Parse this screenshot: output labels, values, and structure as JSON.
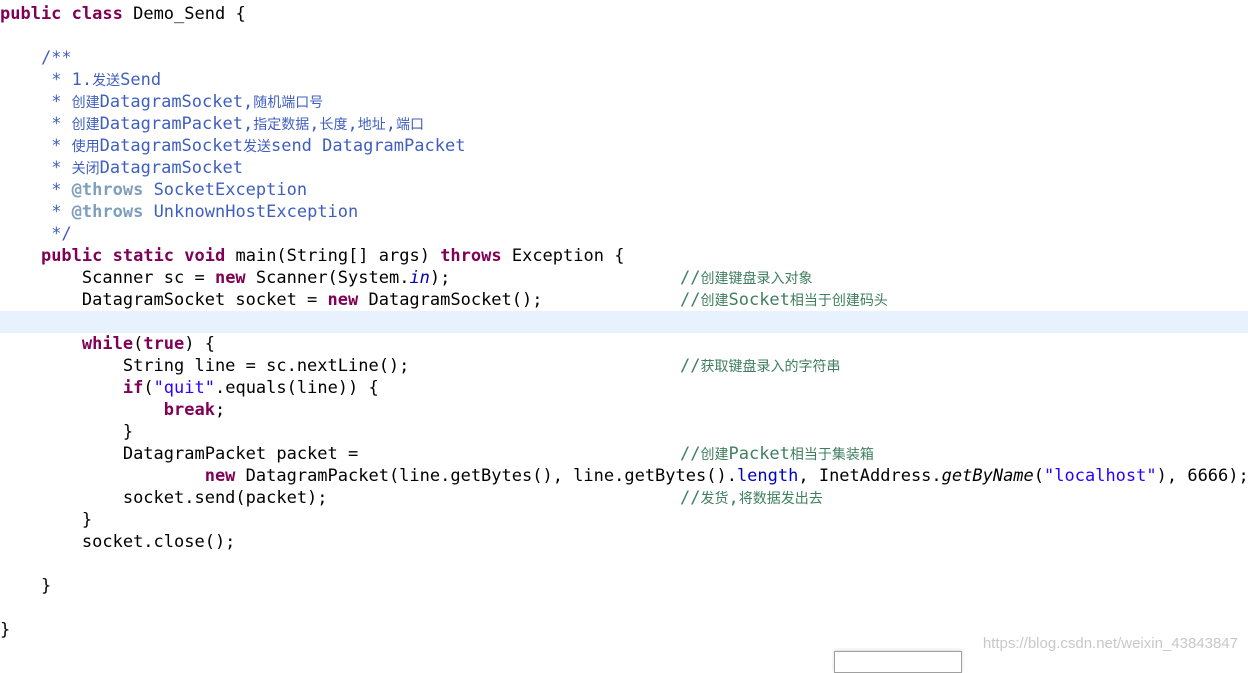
{
  "editor": {
    "language": "java",
    "current_line_index": 14,
    "lines": [
      {
        "indent": 0,
        "tokens": [
          {
            "t": "public",
            "c": "kw"
          },
          {
            "t": " "
          },
          {
            "t": "class",
            "c": "kw"
          },
          {
            "t": " Demo_Send {"
          }
        ]
      },
      {
        "indent": 0,
        "tokens": []
      },
      {
        "indent": 4,
        "tokens": [
          {
            "t": "/**",
            "c": "doc"
          }
        ]
      },
      {
        "indent": 4,
        "tokens": [
          {
            "t": " * 1.",
            "c": "doc"
          },
          {
            "t": "发送",
            "c": "doc cjk"
          },
          {
            "t": "Send",
            "c": "doc"
          }
        ]
      },
      {
        "indent": 4,
        "tokens": [
          {
            "t": " * ",
            "c": "doc"
          },
          {
            "t": "创建",
            "c": "doc cjk"
          },
          {
            "t": "DatagramSocket,",
            "c": "doc"
          },
          {
            "t": "随机端口号",
            "c": "doc cjk"
          }
        ]
      },
      {
        "indent": 4,
        "tokens": [
          {
            "t": " * ",
            "c": "doc"
          },
          {
            "t": "创建",
            "c": "doc cjk"
          },
          {
            "t": "DatagramPacket,",
            "c": "doc"
          },
          {
            "t": "指定数据",
            "c": "doc cjk"
          },
          {
            "t": ",",
            "c": "doc"
          },
          {
            "t": "长度",
            "c": "doc cjk"
          },
          {
            "t": ",",
            "c": "doc"
          },
          {
            "t": "地址",
            "c": "doc cjk"
          },
          {
            "t": ",",
            "c": "doc"
          },
          {
            "t": "端口",
            "c": "doc cjk"
          }
        ]
      },
      {
        "indent": 4,
        "tokens": [
          {
            "t": " * ",
            "c": "doc"
          },
          {
            "t": "使用",
            "c": "doc cjk"
          },
          {
            "t": "DatagramSocket",
            "c": "doc"
          },
          {
            "t": "发送",
            "c": "doc cjk"
          },
          {
            "t": "send DatagramPacket",
            "c": "doc"
          }
        ]
      },
      {
        "indent": 4,
        "tokens": [
          {
            "t": " * ",
            "c": "doc"
          },
          {
            "t": "关闭",
            "c": "doc cjk"
          },
          {
            "t": "DatagramSocket",
            "c": "doc"
          }
        ]
      },
      {
        "indent": 4,
        "tokens": [
          {
            "t": " * ",
            "c": "doc"
          },
          {
            "t": "@throws",
            "c": "doctag"
          },
          {
            "t": " SocketException",
            "c": "doc"
          }
        ]
      },
      {
        "indent": 4,
        "tokens": [
          {
            "t": " * ",
            "c": "doc"
          },
          {
            "t": "@throws",
            "c": "doctag"
          },
          {
            "t": " UnknownHostException",
            "c": "doc"
          }
        ]
      },
      {
        "indent": 4,
        "tokens": [
          {
            "t": " */",
            "c": "doc"
          }
        ]
      },
      {
        "indent": 4,
        "tokens": [
          {
            "t": "public",
            "c": "kw"
          },
          {
            "t": " "
          },
          {
            "t": "static",
            "c": "kw"
          },
          {
            "t": " "
          },
          {
            "t": "void",
            "c": "kw"
          },
          {
            "t": " main(String[] args) "
          },
          {
            "t": "throws",
            "c": "kw"
          },
          {
            "t": " Exception {"
          }
        ]
      },
      {
        "indent": 8,
        "tokens": [
          {
            "t": "Scanner sc = "
          },
          {
            "t": "new",
            "c": "kw"
          },
          {
            "t": " Scanner(System."
          },
          {
            "t": "in",
            "c": "field-static"
          },
          {
            "t": ");"
          }
        ],
        "comment": [
          {
            "t": "//",
            "c": "comment"
          },
          {
            "t": "创建键盘录入对象",
            "c": "comment cjk"
          }
        ]
      },
      {
        "indent": 8,
        "tokens": [
          {
            "t": "DatagramSocket socket = "
          },
          {
            "t": "new",
            "c": "kw"
          },
          {
            "t": " DatagramSocket();"
          }
        ],
        "comment": [
          {
            "t": "//",
            "c": "comment"
          },
          {
            "t": "创建",
            "c": "comment cjk"
          },
          {
            "t": "Socket",
            "c": "comment"
          },
          {
            "t": "相当于创建码头",
            "c": "comment cjk"
          }
        ]
      },
      {
        "indent": 0,
        "tokens": []
      },
      {
        "indent": 8,
        "tokens": [
          {
            "t": "while",
            "c": "kw"
          },
          {
            "t": "("
          },
          {
            "t": "true",
            "c": "kw"
          },
          {
            "t": ") {"
          }
        ]
      },
      {
        "indent": 12,
        "tokens": [
          {
            "t": "String line = sc.nextLine();"
          }
        ],
        "comment": [
          {
            "t": "//",
            "c": "comment"
          },
          {
            "t": "获取键盘录入的字符串",
            "c": "comment cjk"
          }
        ]
      },
      {
        "indent": 12,
        "tokens": [
          {
            "t": "if",
            "c": "kw"
          },
          {
            "t": "("
          },
          {
            "t": "\"quit\"",
            "c": "str"
          },
          {
            "t": ".equals(line)) {"
          }
        ]
      },
      {
        "indent": 16,
        "tokens": [
          {
            "t": "break",
            "c": "kw"
          },
          {
            "t": ";"
          }
        ]
      },
      {
        "indent": 12,
        "tokens": [
          {
            "t": "}"
          }
        ]
      },
      {
        "indent": 12,
        "tokens": [
          {
            "t": "DatagramPacket packet ="
          }
        ],
        "comment": [
          {
            "t": "//",
            "c": "comment"
          },
          {
            "t": "创建",
            "c": "comment cjk"
          },
          {
            "t": "Packet",
            "c": "comment"
          },
          {
            "t": "相当于集装箱",
            "c": "comment cjk"
          }
        ]
      },
      {
        "indent": 20,
        "tokens": [
          {
            "t": "new",
            "c": "kw"
          },
          {
            "t": " DatagramPacket(line.getBytes(), line.getBytes()."
          },
          {
            "t": "length",
            "c": "field"
          },
          {
            "t": ", InetAddress."
          },
          {
            "t": "getByName",
            "c": "method-static"
          },
          {
            "t": "("
          },
          {
            "t": "\"localhost\"",
            "c": "str"
          },
          {
            "t": "), 6666);"
          }
        ]
      },
      {
        "indent": 12,
        "tokens": [
          {
            "t": "socket.send(packet);"
          }
        ],
        "comment": [
          {
            "t": "//",
            "c": "comment"
          },
          {
            "t": "发货",
            "c": "comment cjk"
          },
          {
            "t": ",",
            "c": "comment"
          },
          {
            "t": "将数据发出去",
            "c": "comment cjk"
          }
        ]
      },
      {
        "indent": 8,
        "tokens": [
          {
            "t": "}"
          }
        ]
      },
      {
        "indent": 8,
        "tokens": [
          {
            "t": "socket.close();"
          }
        ]
      },
      {
        "indent": 0,
        "tokens": []
      },
      {
        "indent": 4,
        "tokens": [
          {
            "t": "}"
          }
        ]
      },
      {
        "indent": 0,
        "tokens": []
      },
      {
        "indent": 0,
        "tokens": [
          {
            "t": "}"
          }
        ]
      }
    ]
  },
  "watermark": "https://blog.csdn.net/weixin_43843847",
  "colors": {
    "keyword": "#7f0055",
    "string": "#2a00ff",
    "field": "#0000c0",
    "javadoc": "#3f5fbf",
    "javadoc_tag": "#7f9fbf",
    "comment": "#3f7f5f",
    "current_line": "#e8f2fe"
  }
}
